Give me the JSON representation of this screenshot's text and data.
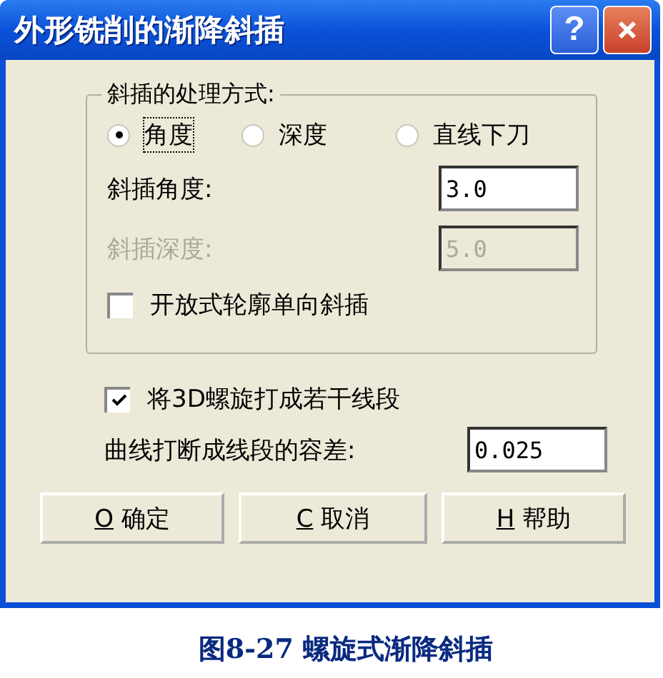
{
  "window": {
    "title": "外形铣削的渐降斜插",
    "title_buttons": [
      {
        "kind": "help",
        "label": "?"
      },
      {
        "kind": "close"
      }
    ]
  },
  "group": {
    "title": "斜插的处理方式:",
    "radios": [
      {
        "label": "角度",
        "selected": true
      },
      {
        "label": "深度",
        "selected": false
      },
      {
        "label": "直线下刀",
        "selected": false
      }
    ],
    "fields": [
      {
        "label": "斜插角度:",
        "value": "3.0",
        "disabled": false
      },
      {
        "label": "斜插深度:",
        "value": "5.0",
        "disabled": true
      }
    ],
    "checkbox": {
      "label": "开放式轮廓单向斜插",
      "checked": false
    }
  },
  "checkbox": {
    "label": "将3D螺旋打成若干线段",
    "checked": true
  },
  "tolerance": {
    "label": "曲线打断成线段的容差:",
    "value": "0.025"
  },
  "buttons": [
    {
      "key": "O",
      "label": "确定"
    },
    {
      "key": "C",
      "label": "取消"
    },
    {
      "key": "H",
      "label": "帮助"
    }
  ],
  "caption": "图8-27  螺旋式渐降斜插"
}
